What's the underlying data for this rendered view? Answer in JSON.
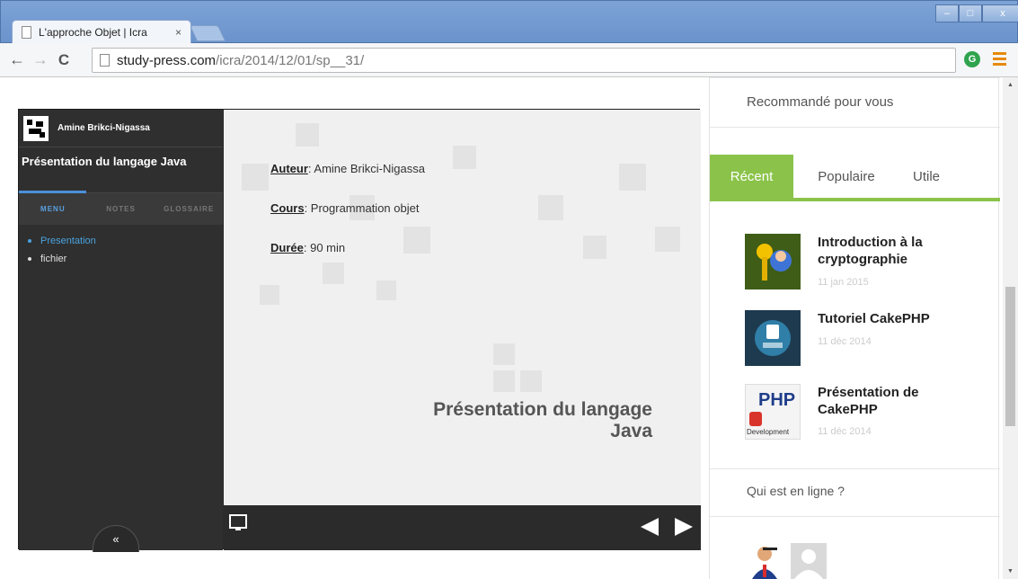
{
  "browser": {
    "tab_title": "L'approche Objet | Icra",
    "tab_close": "×",
    "url_host": "study-press.com",
    "url_path": "/icra/2014/12/01/sp__31/",
    "nav": {
      "back": "←",
      "forward": "→",
      "reload": "C"
    },
    "window_controls": {
      "minimize": "–",
      "maximize": "□",
      "close": "x"
    },
    "extension_glyph": "G"
  },
  "player": {
    "author": "Amine Brikci-Nigassa",
    "course_title": "Présentation du langage Java",
    "tabs": [
      "MENU",
      "NOTES",
      "GLOSSAIRE"
    ],
    "outline": [
      {
        "label": "Presentation",
        "active": true
      },
      {
        "label": "fichier",
        "active": false
      }
    ],
    "collapse_glyph": "«",
    "slide": {
      "author_key": "Auteur",
      "author_value": ": Amine Brikci-Nigassa",
      "course_key": "Cours",
      "course_value": ": Programmation objet",
      "duration_key": "Durée",
      "duration_value": ": 90 min",
      "title_line1": "Présentation du langage",
      "title_line2": "Java"
    }
  },
  "sidebar_right": {
    "recommended_title": "Recommandé pour vous",
    "tabs": [
      {
        "label": "Récent",
        "active": true
      },
      {
        "label": "Populaire",
        "active": false
      },
      {
        "label": "Utile",
        "active": false
      }
    ],
    "posts": [
      {
        "title": "Introduction à la cryptographie",
        "date": "11 jan 2015",
        "thumb_icon": "crypto-keys-icon"
      },
      {
        "title": "Tutoriel CakePHP",
        "date": "11 déc 2014",
        "thumb_icon": "cakephp-logo-icon"
      },
      {
        "title": "Présentation de CakePHP",
        "date": "11 déc 2014",
        "thumb_icon": "php-development-icon",
        "thumb_text": "PHP",
        "thumb_caption": "Development"
      }
    ],
    "online_title": "Qui est en ligne ?"
  },
  "colors": {
    "accent_green": "#8bc34a",
    "player_dark": "#2f2f2f",
    "link_blue": "#4aa3df"
  }
}
